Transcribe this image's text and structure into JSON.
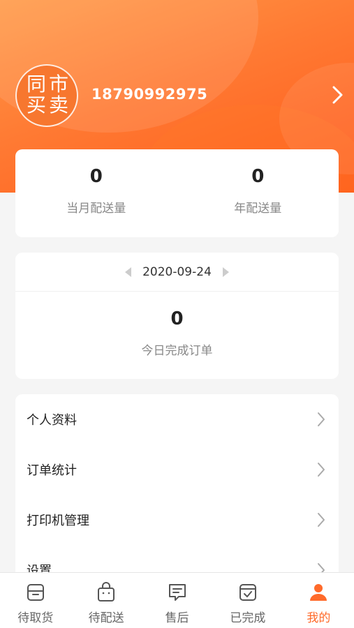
{
  "header": {
    "avatar_chars": [
      "同",
      "市",
      "买",
      "卖"
    ],
    "phone": "18790992975"
  },
  "stats": {
    "monthly": {
      "value": "0",
      "label": "当月配送量"
    },
    "yearly": {
      "value": "0",
      "label": "年配送量"
    }
  },
  "daily": {
    "date": "2020-09-24",
    "completed": "0",
    "completed_label": "今日完成订单"
  },
  "menu": {
    "items": [
      {
        "label": "个人资料"
      },
      {
        "label": "订单统计"
      },
      {
        "label": "打印机管理"
      },
      {
        "label": "设置"
      }
    ]
  },
  "tabs": [
    {
      "label": "待取货",
      "icon": "box-icon",
      "active": false
    },
    {
      "label": "待配送",
      "icon": "bag-icon",
      "active": false
    },
    {
      "label": "售后",
      "icon": "message-icon",
      "active": false
    },
    {
      "label": "已完成",
      "icon": "check-box-icon",
      "active": false
    },
    {
      "label": "我的",
      "icon": "user-icon",
      "active": true
    }
  ],
  "colors": {
    "accent": "#ff6a2a",
    "hero_start": "#ff9a48",
    "hero_end": "#ff5a1a"
  }
}
